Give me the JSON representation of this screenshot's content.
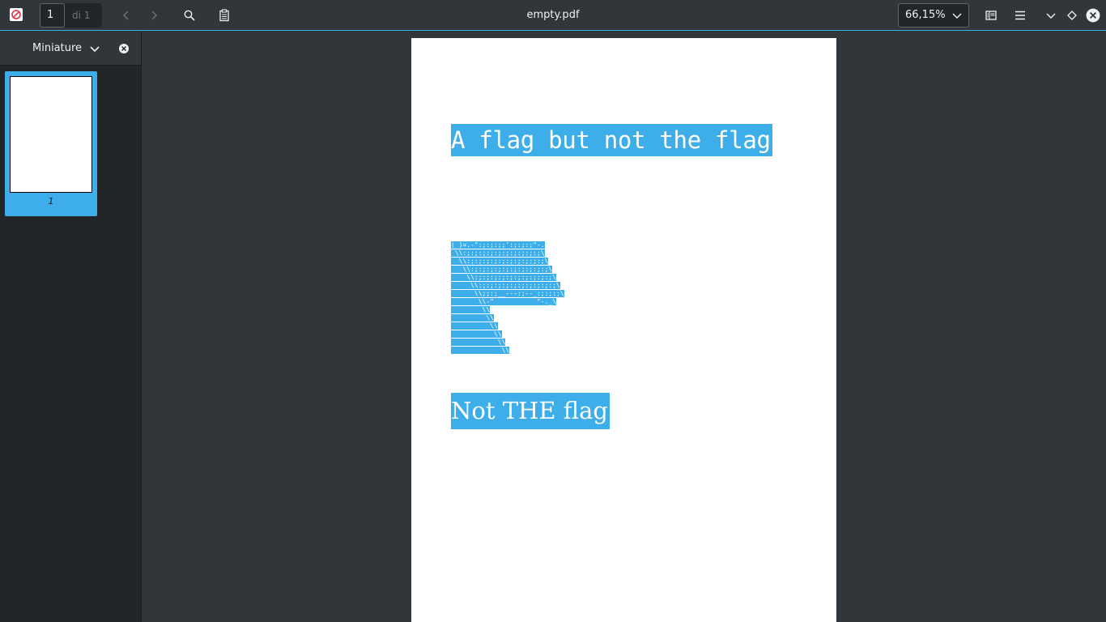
{
  "toolbar": {
    "current_page": "1",
    "page_of": "di 1",
    "document_title": "empty.pdf",
    "zoom": "66,15%"
  },
  "sidebar": {
    "title": "Miniature",
    "thumbnails": [
      {
        "label": "1"
      }
    ]
  },
  "document": {
    "heading": "A flag but not the flag",
    "ascii_flag": [
      "( )=.-\":;:;:;;':;:;:;\"-.",
      " \\\\:;:;:;:;:;:;:;:;:;:;\\",
      "  \\\\:;:;:;:;:;:;:;:;:;:;\\",
      "   \\\\:;:;:;:;:;:;:;:;:;:;\\",
      "    \\\\:;:;:;:;:;:;:;:;:;:;\\",
      "     \\\\:;:;:;:;:;:;:;:;:;:;\\",
      "      \\\\;;:;__---:;--_:;:;:;\\",
      "       \\\\-\"           \"-._\\",
      "        \\\\",
      "         \\\\",
      "          \\\\",
      "           \\\\",
      "            \\\\",
      "             \\\\"
    ],
    "caption": "Not THE flag"
  },
  "colors": {
    "selection": "#3daee9",
    "background": "#31363b",
    "sidebar": "#232629"
  }
}
